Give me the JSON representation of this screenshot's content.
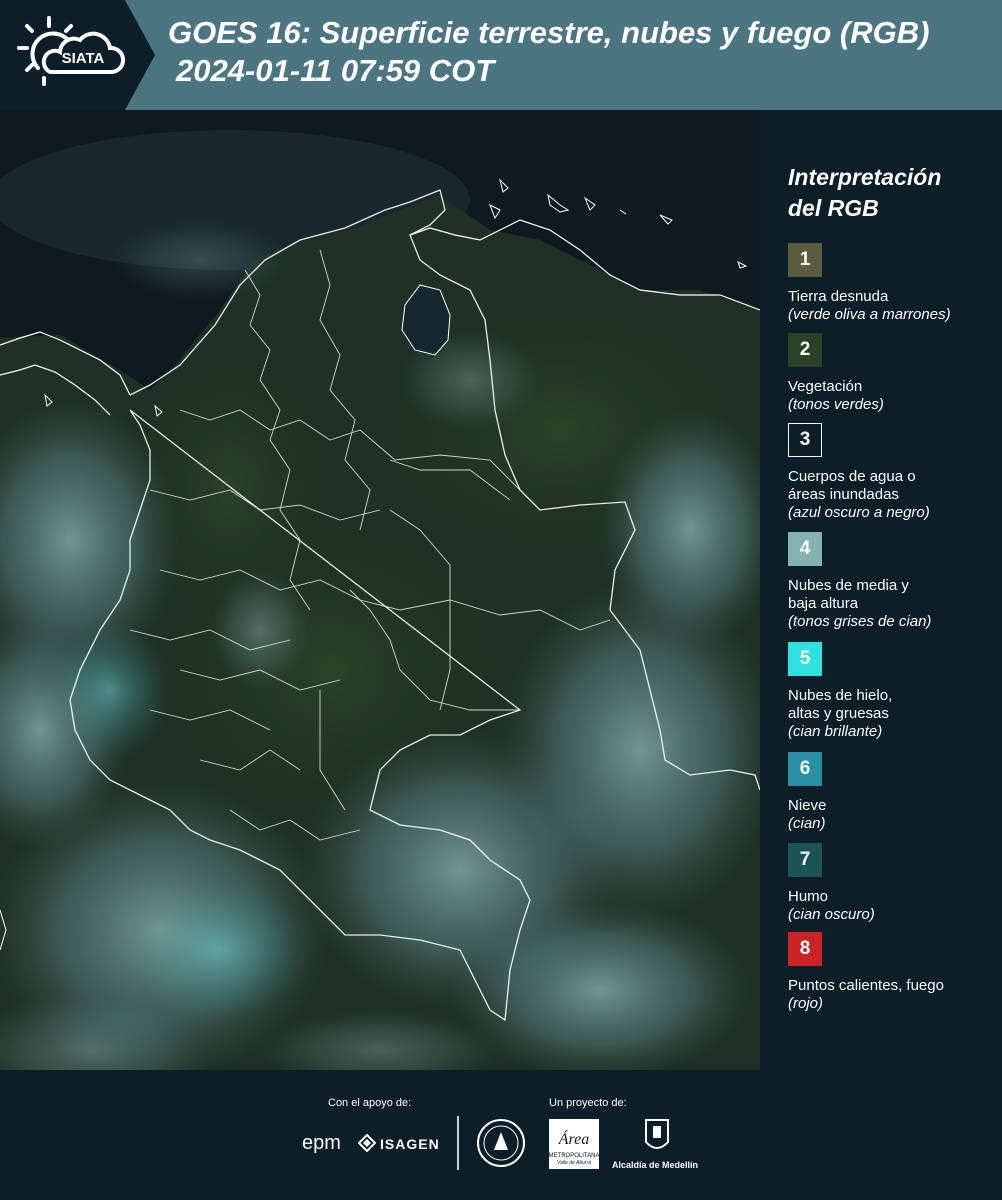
{
  "header": {
    "title_line1": "GOES 16: Superficie terrestre, nubes y fuego (RGB)",
    "title_line2": "2024-01-11 07:59 COT",
    "logo_text": "SIATA",
    "bg_color": "#4c7582",
    "logo_bg_color": "#0c1e28"
  },
  "map": {
    "icon": "satellite-rgb-image",
    "region": "Colombia"
  },
  "legend": {
    "title_line1": "Interpretación",
    "title_line2": "del RGB",
    "items": [
      {
        "number": "1",
        "label": "Tierra desnuda",
        "sub": "(verde oliva a marrones)",
        "color": "#5b5b3e"
      },
      {
        "number": "2",
        "label": "Vegetación",
        "sub": "(tonos verdes)",
        "color": "#2b4125"
      },
      {
        "number": "3",
        "label": "Cuerpos de agua o",
        "label2": "áreas inundadas",
        "sub": "(azul oscuro a negro)",
        "color": "#0c1e28"
      },
      {
        "number": "4",
        "label": "Nubes de media y",
        "label2": "baja altura",
        "sub": "(tonos grises de cian)",
        "color": "#85b3b3"
      },
      {
        "number": "5",
        "label": "Nubes de hielo,",
        "label2": "altas y gruesas",
        "sub": "(cian brillante)",
        "color": "#2ee0e0"
      },
      {
        "number": "6",
        "label": "Nieve",
        "sub": "(cian)",
        "color": "#2a8fa5"
      },
      {
        "number": "7",
        "label": "Humo",
        "sub": "(cian oscuro)",
        "color": "#1b5356"
      },
      {
        "number": "8",
        "label": "Puntos calientes, fuego",
        "sub": "(rojo)",
        "color": "#c92323"
      }
    ]
  },
  "footer": {
    "support_caption": "Con el apoyo de:",
    "project_caption": "Un proyecto de:",
    "sponsor_epm": "epm",
    "sponsor_isagen": "ISAGEN",
    "partner_area_text": "Área",
    "partner_area_sub1": "METROPOLITANA",
    "partner_area_sub2": "Valle de Aburrá",
    "partner_alcaldia": "Alcaldía de Medellín"
  }
}
